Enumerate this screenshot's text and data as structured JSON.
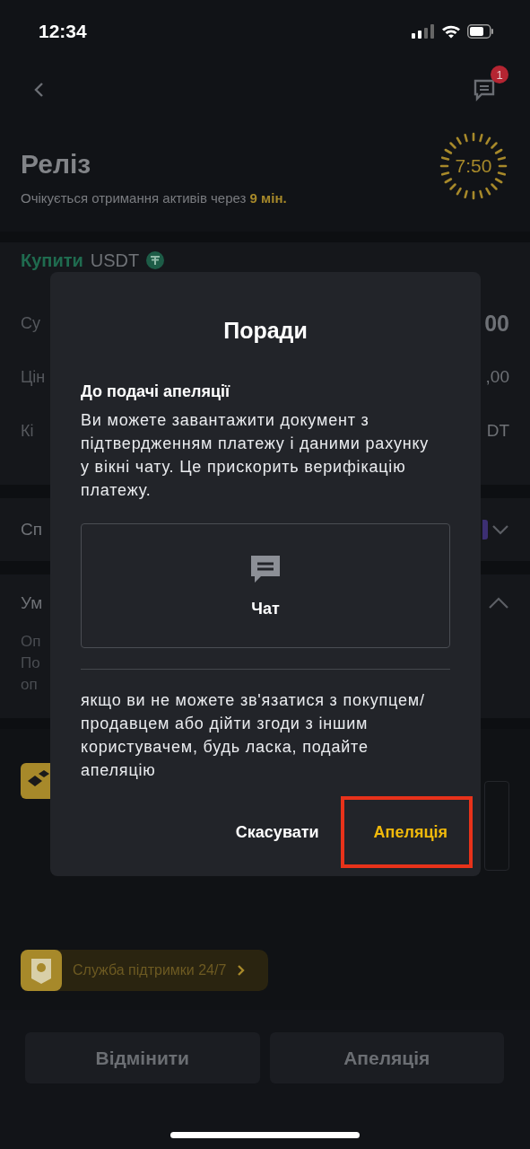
{
  "status_bar": {
    "time": "12:34"
  },
  "nav": {
    "chat_badge": "1"
  },
  "header": {
    "title": "Реліз",
    "subtitle": "Очікується отримання активів через",
    "subtitle_highlight": "9 мін.",
    "timer": "7:50"
  },
  "order": {
    "side": "Купити",
    "asset": "USDT",
    "rows": [
      {
        "label": "Су",
        "value": "00"
      },
      {
        "label": "Цін",
        "value": ",00"
      },
      {
        "label": "Кі",
        "value": "DT"
      }
    ]
  },
  "payment_method": {
    "label": "Сп",
    "expanded": false
  },
  "terms": {
    "label": "Ум",
    "expanded": true,
    "lines": [
      "Оп",
      "По",
      "оп"
    ]
  },
  "support": {
    "label": "Служба підтримки 24/7"
  },
  "actions": [
    {
      "label": "Відмінити"
    },
    {
      "label": "Апеляція"
    }
  ],
  "dialog": {
    "title": "Поради",
    "heading": "До подачі апеляції",
    "body": "Ви можете завантажити документ з підтвердженням платежу і даними рахунку у вікні чату. Це прискорить верифікацію платежу.",
    "chat_label": "Чат",
    "note": "якщо ви не можете зв'язатися з покупцем/ продавцем або дійти згоди з іншим користувачем, будь ласка, подайте апеляцію",
    "buttons": [
      {
        "label": "Скасувати",
        "kind": "secondary",
        "highlighted": false
      },
      {
        "label": "Апеляція",
        "kind": "primary",
        "highlighted": true
      }
    ]
  }
}
